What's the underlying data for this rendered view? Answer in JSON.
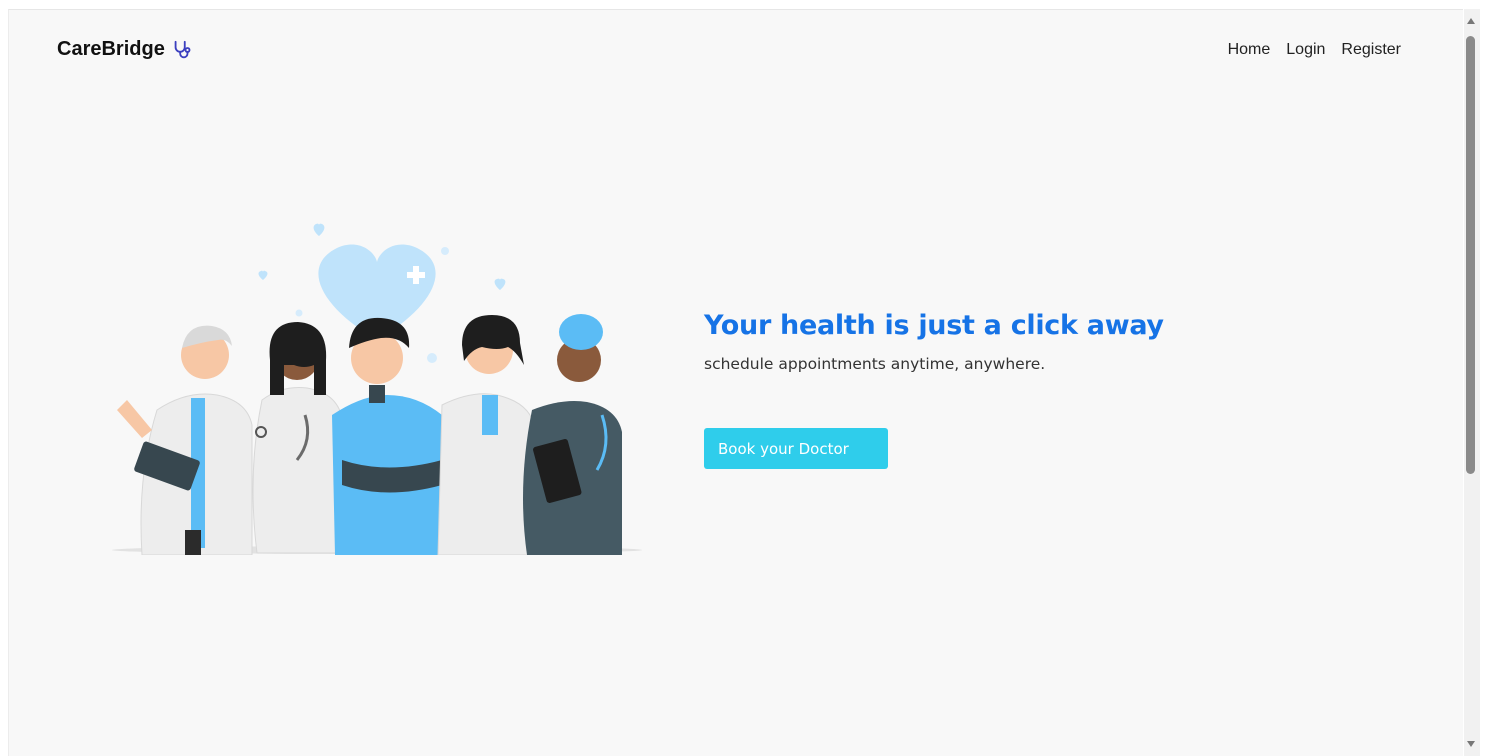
{
  "brand": {
    "name": "CareBridge",
    "icon": "stethoscope-icon"
  },
  "nav": {
    "items": [
      "Home",
      "Login",
      "Register"
    ]
  },
  "hero": {
    "title": "Your health is just a click away",
    "subtitle": "schedule appointments anytime, anywhere.",
    "cta_label": "Book your Doctor"
  },
  "colors": {
    "title": "#1673e6",
    "cta": "#2fcdeb",
    "background": "#f8f8f8",
    "scrub_blue": "#5bbcf5",
    "heart": "#bfe3fb"
  }
}
